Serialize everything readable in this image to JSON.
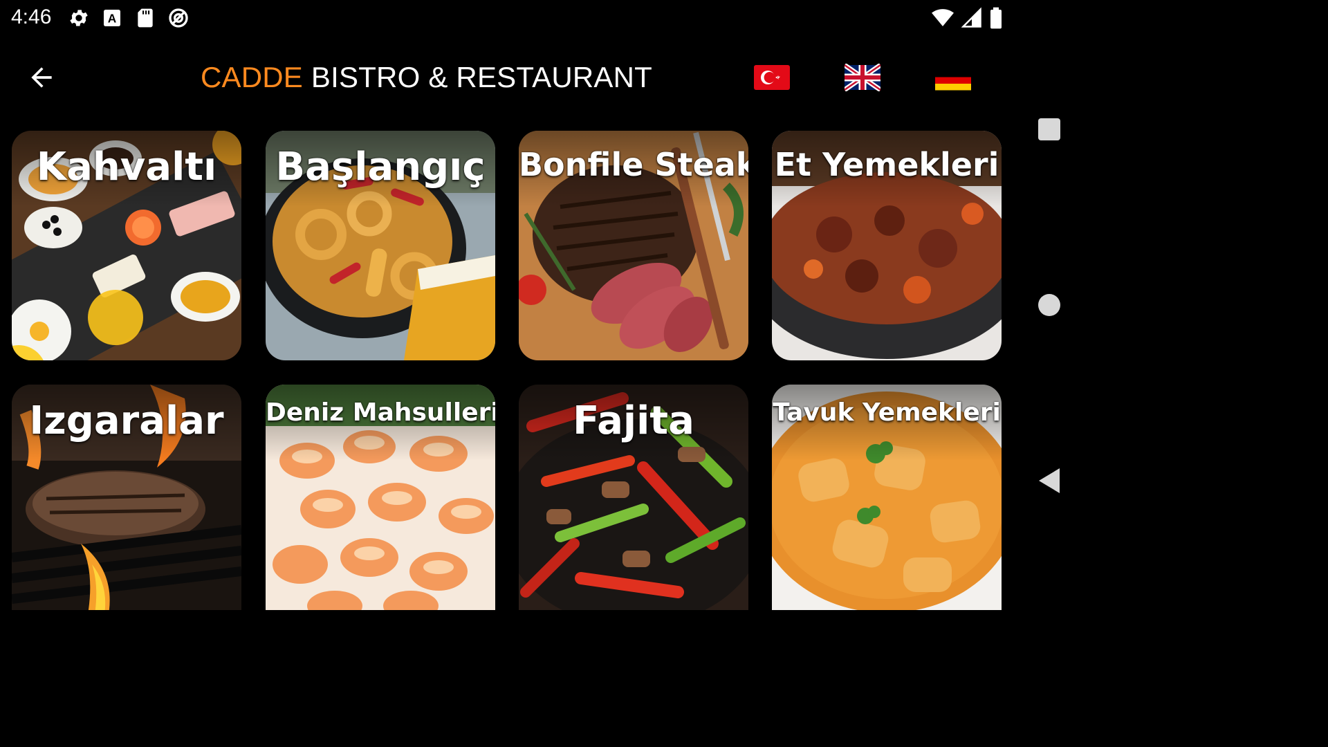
{
  "status_bar": {
    "time": "4:46",
    "left_icons": [
      "gear-icon",
      "a-notification-icon",
      "sd-card-icon",
      "no-disturb-icon"
    ],
    "right_icons": [
      "wifi-icon",
      "cell-signal-icon",
      "battery-icon"
    ]
  },
  "header": {
    "back_icon": "arrow-left-icon",
    "title_accent": "CADDE",
    "title_rest": "BISTRO & RESTAURANT",
    "accent_color": "#ff8a1f",
    "languages": [
      {
        "name": "Türkçe",
        "flag": "turkey-flag-icon"
      },
      {
        "name": "English",
        "flag": "uk-flag-icon"
      },
      {
        "name": "Deutsch",
        "flag": "germany-flag-icon"
      }
    ]
  },
  "categories": [
    {
      "label": "Kahvaltı"
    },
    {
      "label": "Başlangıç"
    },
    {
      "label": "Bonfile Steak"
    },
    {
      "label": "Et Yemekleri"
    },
    {
      "label": "Izgaralar"
    },
    {
      "label": "Deniz Mahsulleri"
    },
    {
      "label": "Fajita"
    },
    {
      "label": "Tavuk Yemekleri"
    }
  ],
  "nav_bar": {
    "buttons": [
      "recents-square-icon",
      "home-circle-icon",
      "back-triangle-icon"
    ]
  }
}
